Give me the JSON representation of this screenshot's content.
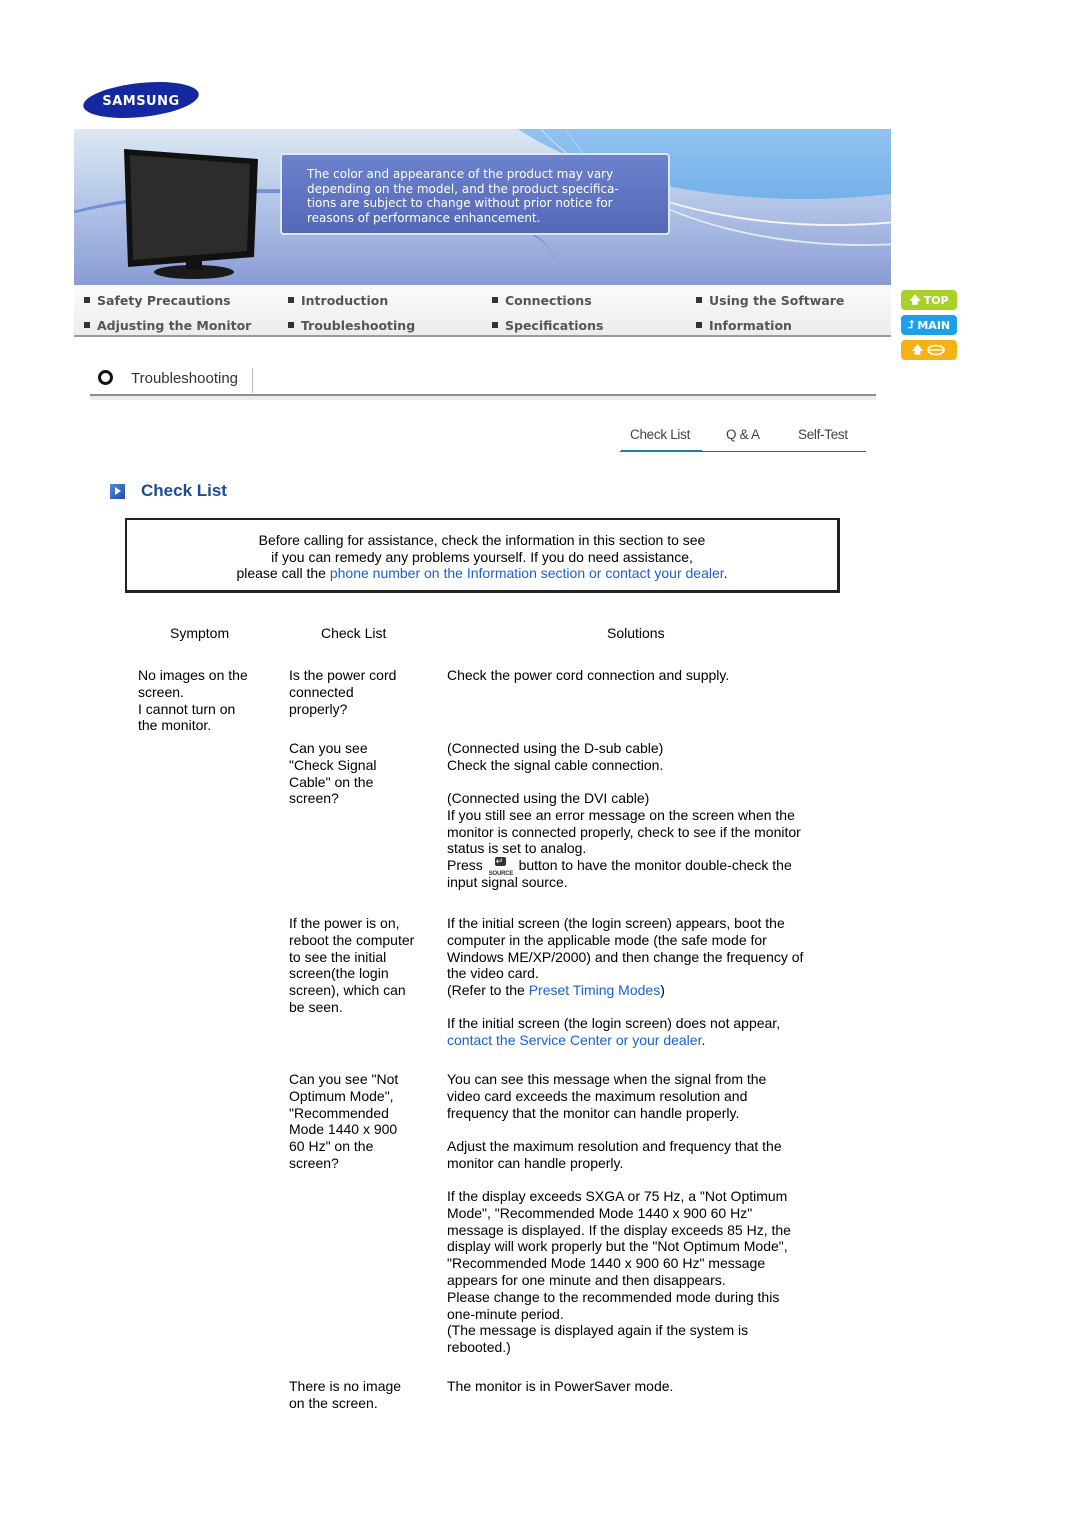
{
  "brand": {
    "logo_text": "SAMSUNG",
    "color": "#1428a0"
  },
  "banner": {
    "notice": "The color and appearance of the product may vary\ndepending on the model, and the product specifica-\ntions are subject to change without prior notice for\nreasons of performance enhancement."
  },
  "nav": {
    "items": [
      {
        "label": "Safety Precautions"
      },
      {
        "label": "Introduction"
      },
      {
        "label": "Connections"
      },
      {
        "label": "Using the Software"
      },
      {
        "label": "Adjusting the Monitor"
      },
      {
        "label": "Troubleshooting"
      },
      {
        "label": "Specifications"
      },
      {
        "label": "Information"
      }
    ]
  },
  "side_buttons": {
    "top": {
      "label": "TOP",
      "color": "#a8d12a"
    },
    "main": {
      "label": "MAIN",
      "color": "#1ea0e8"
    },
    "back": {
      "label": "",
      "color": "#f6b214"
    }
  },
  "section": {
    "title": "Troubleshooting"
  },
  "tabs": [
    {
      "label": "Check List",
      "active": true
    },
    {
      "label": "Q & A",
      "active": false
    },
    {
      "label": "Self-Test",
      "active": false
    }
  ],
  "heading": "Check List",
  "infobox": {
    "line1": "Before calling for assistance, check the information in this section to see",
    "line2": "if you can remedy any problems yourself. If you do need assistance,",
    "line3_prefix": "please call the ",
    "line3_link": "phone number on the Information section or contact your dealer",
    "line3_suffix": "."
  },
  "table": {
    "headers": {
      "symptom": "Symptom",
      "check": "Check List",
      "solutions": "Solutions"
    },
    "symptom": "No images on the\nscreen.\nI cannot turn on\nthe monitor.",
    "rows": [
      {
        "check": "Is the power cord\nconnected\nproperly?",
        "solution": "Check the power cord connection and supply."
      },
      {
        "check": "Can you see\n\"Check Signal\nCable\" on the\nscreen?",
        "solution_a": "(Connected using the D-sub cable)\nCheck the signal cable connection.",
        "solution_b": "(Connected using the DVI cable)\nIf you still see an error message on the screen when the\nmonitor is connected properly, check to see if the monitor\nstatus is set to analog.",
        "press_prefix": "Press ",
        "source_label": "SOURCE",
        "press_suffix": " button to have the monitor double-check the\ninput signal source."
      },
      {
        "check": "If the power is on,\nreboot the computer\nto see the initial\nscreen(the login\nscreen), which can\nbe seen.",
        "solution_a": "If the initial screen (the login screen) appears, boot the\ncomputer in the applicable mode (the safe mode for\nWindows ME/XP/2000) and then change the frequency of\nthe video card.",
        "refer_prefix": "(Refer to the ",
        "refer_link": "Preset Timing Modes",
        "refer_suffix": ")",
        "solution_b": "If the initial screen (the login screen) does not appear,",
        "service_link": "contact the Service Center or your dealer",
        "service_suffix": "."
      },
      {
        "check": "Can you see \"Not\nOptimum Mode\",\n\"Recommended\nMode 1440 x 900\n60 Hz\" on the\nscreen?",
        "solution_a": "You can see this message when the signal from the\nvideo card exceeds the maximum resolution and\nfrequency that the monitor can handle properly.",
        "solution_b": "Adjust the maximum resolution and frequency that the\nmonitor can handle properly.",
        "solution_c": "If the display exceeds SXGA or 75 Hz, a \"Not Optimum\nMode\", \"Recommended Mode 1440 x 900 60 Hz\"\nmessage is displayed. If the display exceeds 85 Hz, the\ndisplay will work properly but the \"Not Optimum Mode\",\n\"Recommended Mode 1440 x 900 60 Hz\" message\nappears for one minute and then disappears.\nPlease change to the recommended mode during this\none-minute period.\n(The message is displayed again if the system is\nrebooted.)"
      },
      {
        "check": "There is no image\non the screen.",
        "solution": "The monitor is in PowerSaver mode."
      }
    ]
  }
}
